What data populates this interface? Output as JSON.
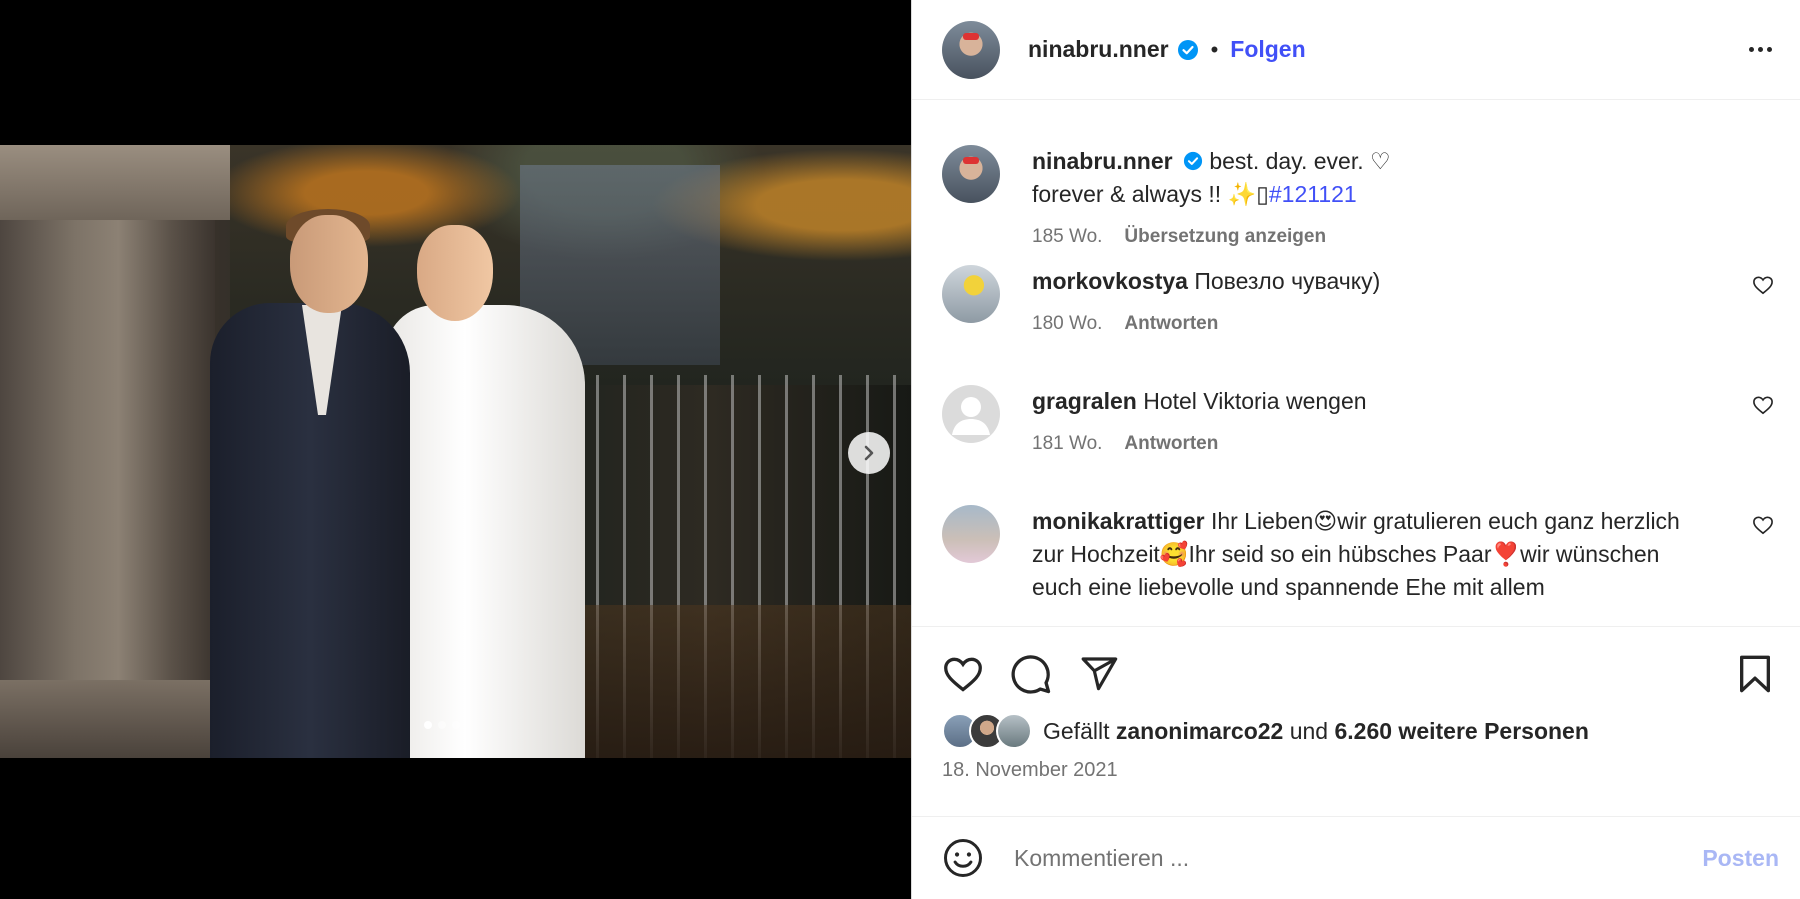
{
  "post": {
    "username": "ninabru.nner",
    "follow_label": "Folgen",
    "separator": "•",
    "caption_line1": "best. day. ever. ♡",
    "caption_line2": "forever & always !! ✨▯",
    "hashtag": "#121121",
    "caption_age": "185 Wo.",
    "translate_label": "Übersetzung anzeigen"
  },
  "comments": [
    {
      "username": "morkovkostya",
      "text": "Повезло чувачку)",
      "age": "180 Wo.",
      "reply_label": "Antworten"
    },
    {
      "username": "gragralen",
      "text": "Hotel Viktoria wengen",
      "age": "181 Wo.",
      "reply_label": "Antworten"
    },
    {
      "username": "monikakrattiger",
      "text": "Ihr Lieben😍wir gratulieren euch ganz herzlich zur Hochzeit🥰Ihr seid so ein hübsches Paar❣️wir wünschen euch eine liebevolle und spannende Ehe mit allem"
    }
  ],
  "likes": {
    "prefix": "Gefällt",
    "liker": "zanonimarco22",
    "and": "und",
    "others": "6.260 weitere Personen"
  },
  "date": "18. November 2021",
  "composer": {
    "placeholder": "Kommentieren ...",
    "post_label": "Posten"
  },
  "carousel": {
    "slide_count": 3,
    "active_index": 0
  },
  "colors": {
    "link_blue": "#4150f7",
    "verified_blue": "#0095f6",
    "muted": "#737373",
    "post_disabled": "#a9b7f5"
  },
  "icons": [
    "verified-icon",
    "more-icon",
    "heart-icon",
    "comment-icon",
    "share-icon",
    "bookmark-icon",
    "emoji-icon",
    "chevron-right-icon"
  ]
}
